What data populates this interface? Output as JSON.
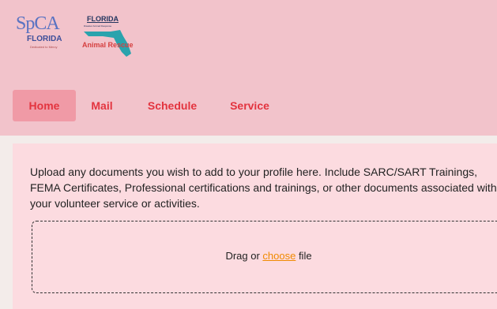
{
  "logos": {
    "spca": {
      "main": "SpCA",
      "sub": "FLORIDA",
      "tagline": "Dedicated to Mercy"
    },
    "far": {
      "title": "FLORIDA",
      "sub": "Disaster Animal Response",
      "name": "Animal Rescue"
    }
  },
  "nav": {
    "items": [
      {
        "label": "Home",
        "active": true
      },
      {
        "label": "Mail",
        "active": false
      },
      {
        "label": "Schedule",
        "active": false
      },
      {
        "label": "Service",
        "active": false
      }
    ]
  },
  "upload": {
    "instructions": "Upload any documents you wish to add to your profile here. Include SARC/SART Trainings, FEMA Certificates, Professional certifications and trainings, or other documents associated with your volunteer service or activities.",
    "drop_prefix": "Drag or ",
    "choose_label": "choose",
    "drop_suffix": " file"
  },
  "colors": {
    "header_bg": "#f2c3cb",
    "nav_text": "#e3343f",
    "nav_active_bg": "#f09aa6",
    "panel_bg": "#fcdbe0",
    "link": "#f08a00"
  }
}
